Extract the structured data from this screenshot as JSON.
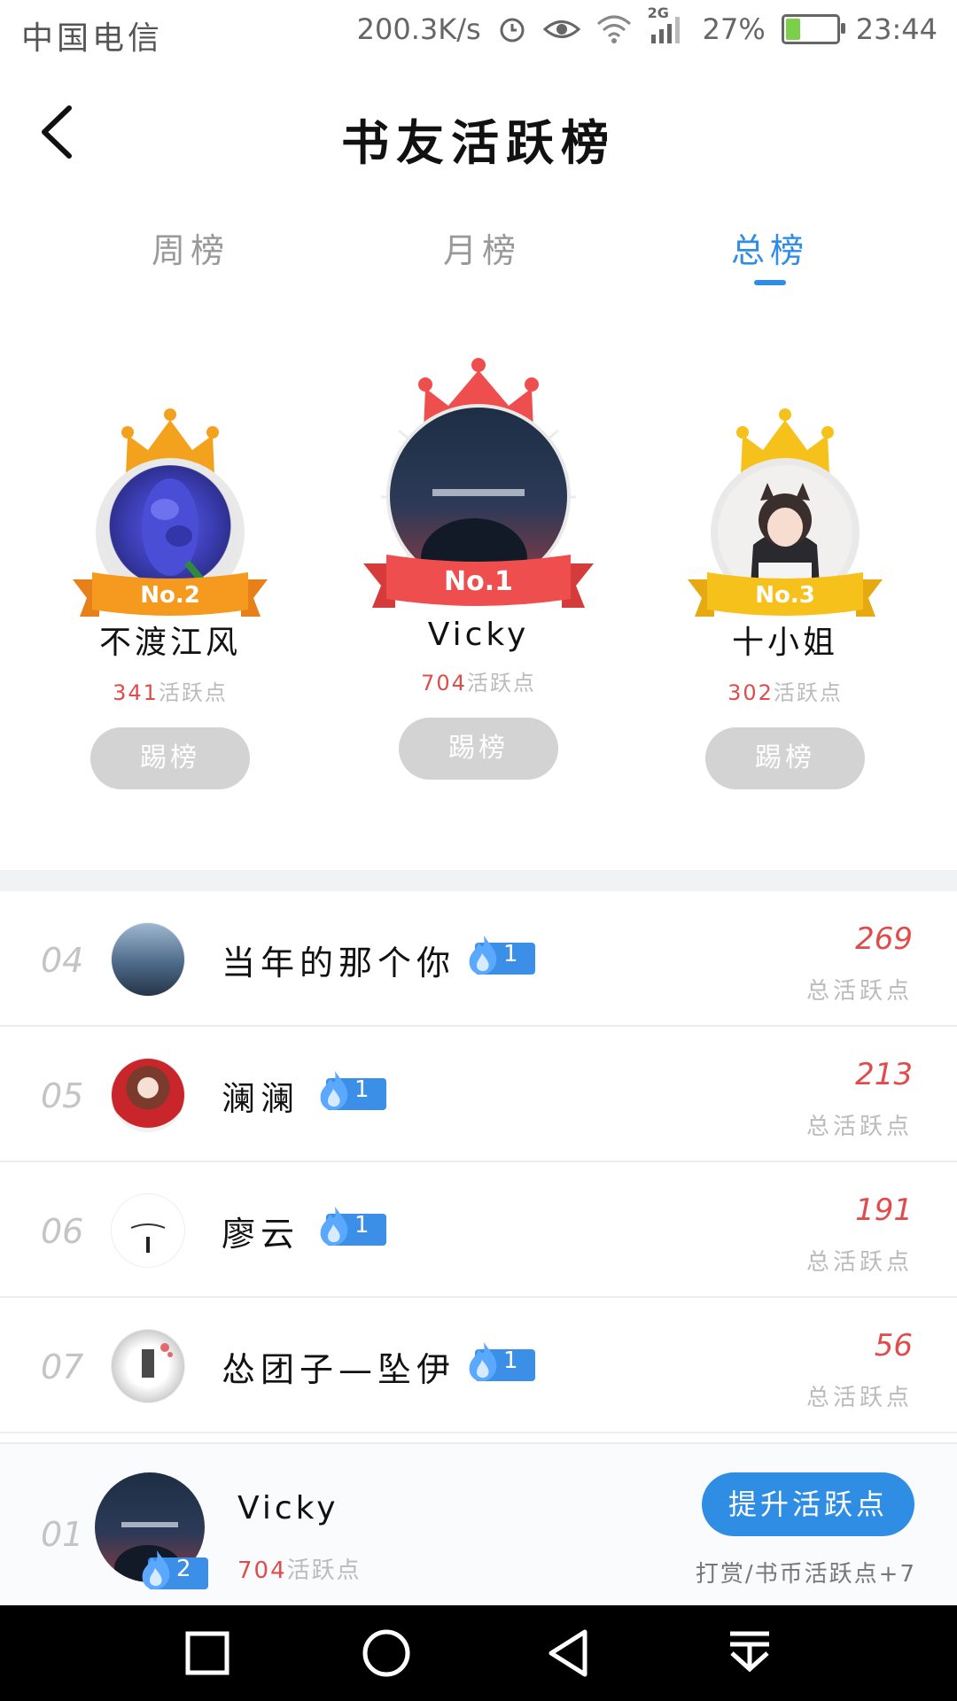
{
  "status_bar": {
    "carrier": "中国电信",
    "speed": "200.3K/s",
    "network": "2G",
    "battery": "27%",
    "battery_level": 0.27,
    "time": "23:44",
    "icons": [
      "alarm-icon",
      "eye-icon",
      "wifi-icon",
      "signal-icon",
      "battery-icon"
    ]
  },
  "header": {
    "title": "书友活跃榜"
  },
  "tabs": [
    {
      "label": "周榜",
      "active": false
    },
    {
      "label": "月榜",
      "active": false
    },
    {
      "label": "总榜",
      "active": true
    }
  ],
  "podium": {
    "kick_label": "踢榜",
    "points_suffix": "活跃点",
    "entries": [
      {
        "badge": "No.2",
        "name": "不渡江风",
        "points": "341",
        "crown_color": "#f3a21d"
      },
      {
        "badge": "No.1",
        "name": "Vicky",
        "points": "704",
        "crown_color": "#ef4e4e"
      },
      {
        "badge": "No.3",
        "name": "十小姐",
        "points": "302",
        "crown_color": "#f6c11a"
      }
    ]
  },
  "list": {
    "points_label": "总活跃点",
    "rows": [
      {
        "rank": "04",
        "name": "当年的那个你",
        "level": "1",
        "points": "269"
      },
      {
        "rank": "05",
        "name": "澜澜",
        "level": "1",
        "points": "213"
      },
      {
        "rank": "06",
        "name": "廖云",
        "level": "1",
        "points": "191"
      },
      {
        "rank": "07",
        "name": "怂团子—坠伊",
        "level": "1",
        "points": "56"
      }
    ]
  },
  "me": {
    "rank": "01",
    "name": "Vicky",
    "level": "2",
    "points": "704",
    "points_suffix": "活跃点",
    "boost_label": "提升活跃点",
    "note": "打赏/书币活跃点+7"
  },
  "colors": {
    "accent": "#2f8de4",
    "points_red": "#e04c4c"
  },
  "nav": [
    "recent-apps-icon",
    "home-icon",
    "back-icon",
    "notification-pull-icon"
  ]
}
